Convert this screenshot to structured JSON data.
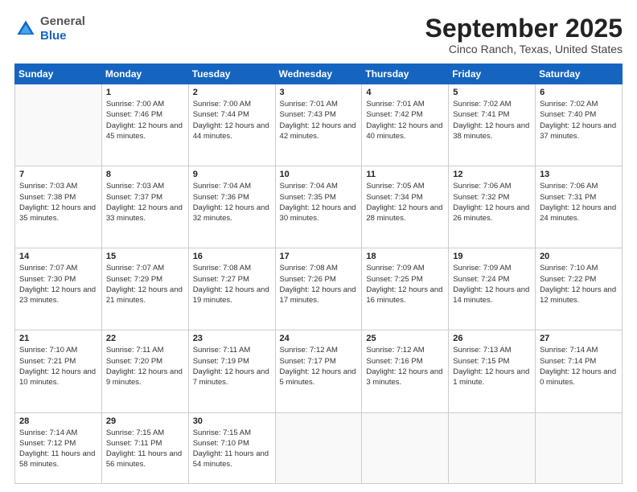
{
  "header": {
    "logo": {
      "general": "General",
      "blue": "Blue"
    },
    "title": "September 2025",
    "location": "Cinco Ranch, Texas, United States"
  },
  "weekdays": [
    "Sunday",
    "Monday",
    "Tuesday",
    "Wednesday",
    "Thursday",
    "Friday",
    "Saturday"
  ],
  "weeks": [
    [
      null,
      {
        "day": 1,
        "sunrise": "7:00 AM",
        "sunset": "7:46 PM",
        "daylight": "12 hours and 45 minutes."
      },
      {
        "day": 2,
        "sunrise": "7:00 AM",
        "sunset": "7:44 PM",
        "daylight": "12 hours and 44 minutes."
      },
      {
        "day": 3,
        "sunrise": "7:01 AM",
        "sunset": "7:43 PM",
        "daylight": "12 hours and 42 minutes."
      },
      {
        "day": 4,
        "sunrise": "7:01 AM",
        "sunset": "7:42 PM",
        "daylight": "12 hours and 40 minutes."
      },
      {
        "day": 5,
        "sunrise": "7:02 AM",
        "sunset": "7:41 PM",
        "daylight": "12 hours and 38 minutes."
      },
      {
        "day": 6,
        "sunrise": "7:02 AM",
        "sunset": "7:40 PM",
        "daylight": "12 hours and 37 minutes."
      }
    ],
    [
      {
        "day": 7,
        "sunrise": "7:03 AM",
        "sunset": "7:38 PM",
        "daylight": "12 hours and 35 minutes."
      },
      {
        "day": 8,
        "sunrise": "7:03 AM",
        "sunset": "7:37 PM",
        "daylight": "12 hours and 33 minutes."
      },
      {
        "day": 9,
        "sunrise": "7:04 AM",
        "sunset": "7:36 PM",
        "daylight": "12 hours and 32 minutes."
      },
      {
        "day": 10,
        "sunrise": "7:04 AM",
        "sunset": "7:35 PM",
        "daylight": "12 hours and 30 minutes."
      },
      {
        "day": 11,
        "sunrise": "7:05 AM",
        "sunset": "7:34 PM",
        "daylight": "12 hours and 28 minutes."
      },
      {
        "day": 12,
        "sunrise": "7:06 AM",
        "sunset": "7:32 PM",
        "daylight": "12 hours and 26 minutes."
      },
      {
        "day": 13,
        "sunrise": "7:06 AM",
        "sunset": "7:31 PM",
        "daylight": "12 hours and 24 minutes."
      }
    ],
    [
      {
        "day": 14,
        "sunrise": "7:07 AM",
        "sunset": "7:30 PM",
        "daylight": "12 hours and 23 minutes."
      },
      {
        "day": 15,
        "sunrise": "7:07 AM",
        "sunset": "7:29 PM",
        "daylight": "12 hours and 21 minutes."
      },
      {
        "day": 16,
        "sunrise": "7:08 AM",
        "sunset": "7:27 PM",
        "daylight": "12 hours and 19 minutes."
      },
      {
        "day": 17,
        "sunrise": "7:08 AM",
        "sunset": "7:26 PM",
        "daylight": "12 hours and 17 minutes."
      },
      {
        "day": 18,
        "sunrise": "7:09 AM",
        "sunset": "7:25 PM",
        "daylight": "12 hours and 16 minutes."
      },
      {
        "day": 19,
        "sunrise": "7:09 AM",
        "sunset": "7:24 PM",
        "daylight": "12 hours and 14 minutes."
      },
      {
        "day": 20,
        "sunrise": "7:10 AM",
        "sunset": "7:22 PM",
        "daylight": "12 hours and 12 minutes."
      }
    ],
    [
      {
        "day": 21,
        "sunrise": "7:10 AM",
        "sunset": "7:21 PM",
        "daylight": "12 hours and 10 minutes."
      },
      {
        "day": 22,
        "sunrise": "7:11 AM",
        "sunset": "7:20 PM",
        "daylight": "12 hours and 9 minutes."
      },
      {
        "day": 23,
        "sunrise": "7:11 AM",
        "sunset": "7:19 PM",
        "daylight": "12 hours and 7 minutes."
      },
      {
        "day": 24,
        "sunrise": "7:12 AM",
        "sunset": "7:17 PM",
        "daylight": "12 hours and 5 minutes."
      },
      {
        "day": 25,
        "sunrise": "7:12 AM",
        "sunset": "7:16 PM",
        "daylight": "12 hours and 3 minutes."
      },
      {
        "day": 26,
        "sunrise": "7:13 AM",
        "sunset": "7:15 PM",
        "daylight": "12 hours and 1 minute."
      },
      {
        "day": 27,
        "sunrise": "7:14 AM",
        "sunset": "7:14 PM",
        "daylight": "12 hours and 0 minutes."
      }
    ],
    [
      {
        "day": 28,
        "sunrise": "7:14 AM",
        "sunset": "7:12 PM",
        "daylight": "11 hours and 58 minutes."
      },
      {
        "day": 29,
        "sunrise": "7:15 AM",
        "sunset": "7:11 PM",
        "daylight": "11 hours and 56 minutes."
      },
      {
        "day": 30,
        "sunrise": "7:15 AM",
        "sunset": "7:10 PM",
        "daylight": "11 hours and 54 minutes."
      },
      null,
      null,
      null,
      null
    ]
  ]
}
